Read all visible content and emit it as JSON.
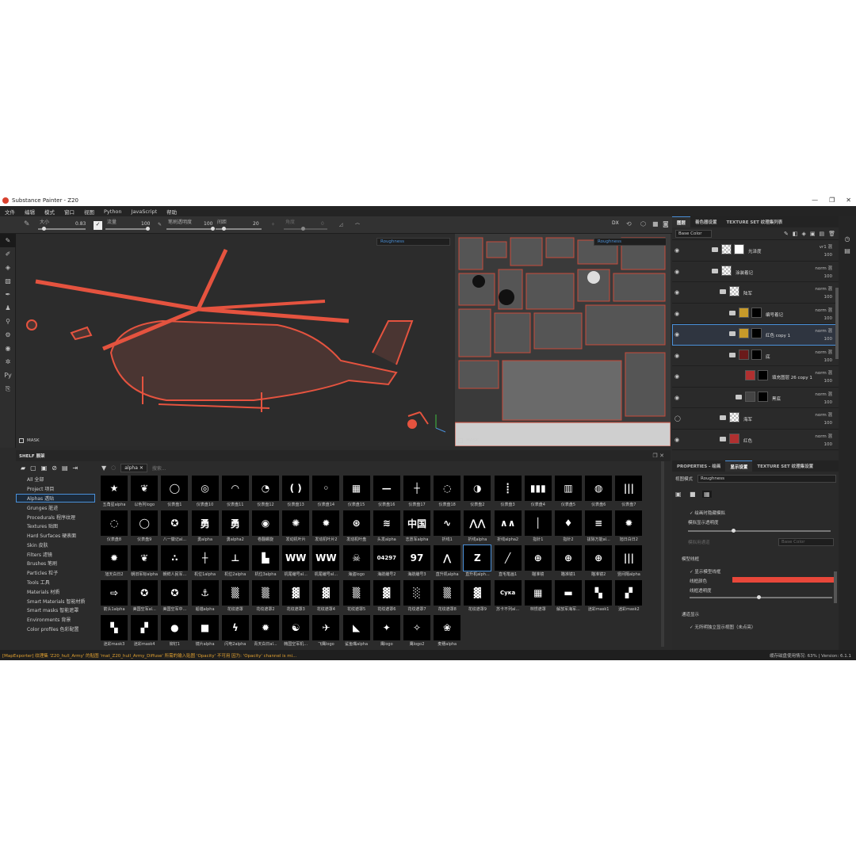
{
  "window": {
    "title": "Substance Painter - Z20"
  },
  "menu": [
    "文件",
    "编辑",
    "模式",
    "窗口",
    "视图",
    "Python",
    "JavaScript",
    "帮助"
  ],
  "toolbar": {
    "size_label": "大小",
    "size_value": "0.83",
    "flow_label": "流量",
    "flow_value": "100",
    "opacity_label": "笔刷透明度",
    "opacity_value": "100",
    "spacing_label": "间距",
    "spacing_value": "20",
    "angle_label": "角度",
    "angle_value": "0",
    "dx_label": "DX"
  },
  "viewport": {
    "channel_3d": "Roughness",
    "channel_2d": "Roughness",
    "mask_label": "MASK"
  },
  "layers_panel": {
    "tabs": [
      "图层",
      "着色器设置",
      "TEXTURE SET 纹理集列表"
    ],
    "channel": "Base Color",
    "layers": [
      {
        "name": "光泽度",
        "blend": "vr1",
        "opacity": "100",
        "thumb": "white"
      },
      {
        "name": "涂装着记",
        "blend": "norm",
        "opacity": "100",
        "thumb": "folder"
      },
      {
        "name": "陆军",
        "blend": "norm",
        "opacity": "100",
        "thumb": "checker"
      },
      {
        "name": "编号着记",
        "blend": "norm",
        "opacity": "100",
        "thumb": "gold"
      },
      {
        "name": "红色 copy 1",
        "blend": "norm",
        "opacity": "100",
        "thumb": "gold"
      },
      {
        "name": "底",
        "blend": "norm",
        "opacity": "100",
        "thumb": "darkred"
      },
      {
        "name": "填充图层 26 copy 1",
        "blend": "norm",
        "opacity": "100",
        "thumb": "red"
      },
      {
        "name": "黑底",
        "blend": "norm",
        "opacity": "100",
        "thumb": "gray"
      },
      {
        "name": "海军",
        "blend": "norm",
        "opacity": "100",
        "thumb": "checker"
      },
      {
        "name": "红色",
        "blend": "norm",
        "opacity": "100",
        "thumb": "red"
      }
    ],
    "blend_suffix": "混"
  },
  "properties": {
    "tabs": [
      "PROPERTIES - 绘画",
      "显示设置",
      "TEXTURE SET 纹理集设置"
    ],
    "view_mode_label": "视图模式",
    "view_mode_value": "Roughness",
    "hide_on_paint": "绘画时隐藏模拟",
    "mesh_opacity_label": "模拟显示透明度",
    "mesh_channel_label": "模拟用通道",
    "mesh_channel_value": "Base Color",
    "wireframe_header": "模型线框",
    "show_wireframe": "显示模型线框",
    "wire_color_label": "线框颜色",
    "wire_opacity_label": "线框透明度",
    "channel_display_header": "通道显示",
    "seamless_label": "无所明独立显示视图（未点亮）",
    "accent": "#e8473a"
  },
  "shelf": {
    "title": "SHELF 展架",
    "search_tag": "alpha",
    "search_placeholder": "搜索...",
    "categories": [
      "All 全部",
      "Project 项目",
      "Alphas 透贴",
      "Grunges 脏迹",
      "Procedurals 程序纹理",
      "Textures 贴图",
      "Hard Surfaces 硬表面",
      "Skin 皮肤",
      "Filters 滤镜",
      "Brushes 笔刷",
      "Particles 粒子",
      "Tools 工具",
      "Materials 材质",
      "Smart Materials 智能材质",
      "Smart masks 智能遮罩",
      "Environments 背景",
      "Color profiles 色彩配置"
    ],
    "selected_category": 2,
    "assets": [
      {
        "label": "五角星alpha",
        "g": "★"
      },
      {
        "label": "以色列logo",
        "g": "❦"
      },
      {
        "label": "仪表盘1",
        "g": "◯"
      },
      {
        "label": "仪表盘10",
        "g": "◎"
      },
      {
        "label": "仪表盘11",
        "g": "◠"
      },
      {
        "label": "仪表盘12",
        "g": "◔"
      },
      {
        "label": "仪表盘13",
        "g": "( )"
      },
      {
        "label": "仪表盘14",
        "g": "◦"
      },
      {
        "label": "仪表盘15",
        "g": "▦"
      },
      {
        "label": "仪表盘16",
        "g": "—"
      },
      {
        "label": "仪表盘17",
        "g": "┼"
      },
      {
        "label": "仪表盘18",
        "g": "◌"
      },
      {
        "label": "仪表盘2",
        "g": "◑"
      },
      {
        "label": "仪表盘3",
        "g": "┋"
      },
      {
        "label": "仪表盘4",
        "g": "▮▮▮"
      },
      {
        "label": "仪表盘5",
        "g": "▥"
      },
      {
        "label": "仪表盘6",
        "g": "◍"
      },
      {
        "label": "仪表盘7",
        "g": "|||"
      },
      {
        "label": "仪表盘8",
        "g": "◌"
      },
      {
        "label": "仪表盘9",
        "g": "◯"
      },
      {
        "label": "八一徽记al...",
        "g": "✪"
      },
      {
        "label": "勇alpha",
        "g": "勇"
      },
      {
        "label": "勇alpha2",
        "g": "勇"
      },
      {
        "label": "卷翻螺旋",
        "g": "◉"
      },
      {
        "label": "发动机叶片",
        "g": "✺"
      },
      {
        "label": "发动机叶片2",
        "g": "✹"
      },
      {
        "label": "发动机叶盘",
        "g": "⊛"
      },
      {
        "label": "头发alpha",
        "g": "≋"
      },
      {
        "label": "志愿军alpha",
        "g": "中国"
      },
      {
        "label": "折线1",
        "g": "∿"
      },
      {
        "label": "折线alpha",
        "g": "⋀⋀"
      },
      {
        "label": "折线alpha2",
        "g": "∧∧"
      },
      {
        "label": "指针1",
        "g": "│"
      },
      {
        "label": "指针2",
        "g": "♦"
      },
      {
        "label": "拔除万能al...",
        "g": "≡"
      },
      {
        "label": "旭日白日2",
        "g": "✹"
      },
      {
        "label": "旭天白日2",
        "g": "✹"
      },
      {
        "label": "朝旧军标alpha",
        "g": "❦"
      },
      {
        "label": "朝鲜人民军...",
        "g": "∴"
      },
      {
        "label": "机位1alpha",
        "g": "┼"
      },
      {
        "label": "机位2alpha",
        "g": "⊥"
      },
      {
        "label": "机位3alpha",
        "g": "▙"
      },
      {
        "label": "机尾编号al...",
        "g": "WW"
      },
      {
        "label": "机尾编号al...",
        "g": "WW"
      },
      {
        "label": "海盗logo",
        "g": "☠"
      },
      {
        "label": "海航编号2",
        "g": "04297"
      },
      {
        "label": "海航编号3",
        "g": "97"
      },
      {
        "label": "直升机alpha",
        "g": "⋀"
      },
      {
        "label": "直升机alph...",
        "g": "Z"
      },
      {
        "label": "直毛笔画1",
        "g": "╱"
      },
      {
        "label": "瞄准镜",
        "g": "⊕"
      },
      {
        "label": "瞄准镜1",
        "g": "⊕"
      },
      {
        "label": "瞄准镜2",
        "g": "⊕"
      },
      {
        "label": "竖间隔alpha",
        "g": "|||"
      },
      {
        "label": "箭头1alpha",
        "g": "⇨"
      },
      {
        "label": "美国空军al...",
        "g": "✪"
      },
      {
        "label": "美国空军中...",
        "g": "✪"
      },
      {
        "label": "船锚alpha",
        "g": "⚓"
      },
      {
        "label": "花纹遮罩",
        "g": "▒"
      },
      {
        "label": "花纹遮罩2",
        "g": "▒"
      },
      {
        "label": "花纹遮罩3",
        "g": "▓"
      },
      {
        "label": "花纹遮罩4",
        "g": "▓"
      },
      {
        "label": "花纹遮罩5",
        "g": "▒"
      },
      {
        "label": "花纹遮罩6",
        "g": "▓"
      },
      {
        "label": "花纹遮罩7",
        "g": "░"
      },
      {
        "label": "花纹遮罩8",
        "g": "▒"
      },
      {
        "label": "花纹遮罩9",
        "g": "▓"
      },
      {
        "label": "苏卡不列al...",
        "g": "Сука"
      },
      {
        "label": "林惯遮罩",
        "g": "▦"
      },
      {
        "label": "解放军海军...",
        "g": "▬"
      },
      {
        "label": "迷彩mask1",
        "g": "▚"
      },
      {
        "label": "迷彩mask2",
        "g": "▞"
      },
      {
        "label": "迷彩mask3",
        "g": "▚"
      },
      {
        "label": "迷彩mask4",
        "g": "▞"
      },
      {
        "label": "铆钉1",
        "g": "●"
      },
      {
        "label": "镜片alpha",
        "g": "■"
      },
      {
        "label": "闪电2alpha",
        "g": "ϟ"
      },
      {
        "label": "青天白日al...",
        "g": "✹"
      },
      {
        "label": "韩国空军机...",
        "g": "☯"
      },
      {
        "label": "飞鹰logo",
        "g": "✈"
      },
      {
        "label": "鲨鱼嘴alpha",
        "g": "◣"
      },
      {
        "label": "鹰logo",
        "g": "✦"
      },
      {
        "label": "鹰logo2",
        "g": "✧"
      },
      {
        "label": "麦穗alpha",
        "g": "❀"
      }
    ],
    "selected_asset": 48
  },
  "status": {
    "message": "[MapExporter] 纹理集 'Z20_hull_Army' 的贴图 'mat_Z20_hull_Army_Diffuse' 所需的输入贴图 'Opacity' 不可用 因为: 'Opacity' channel is mi...",
    "cache_label": "缓存磁盘使用情况:",
    "cache_value": "63%",
    "version": "Version: 6.1.1"
  }
}
